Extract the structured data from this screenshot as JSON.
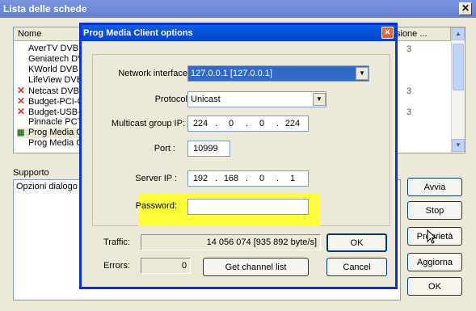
{
  "back": {
    "title": "Lista delle schede",
    "close_label": "✕",
    "headers": {
      "name": "Nome",
      "version": "sione ..."
    },
    "rows": [
      {
        "label": "AverTV DVB",
        "icon": ""
      },
      {
        "label": "Geniatech DV",
        "icon": ""
      },
      {
        "label": "KWorld DVB",
        "icon": ""
      },
      {
        "label": "LifeView DVB",
        "icon": ""
      },
      {
        "label": "Netcast DVB",
        "icon": "✕"
      },
      {
        "label": "Budget-PCI-C",
        "icon": "✕"
      },
      {
        "label": "Budget-USB-",
        "icon": "✕"
      },
      {
        "label": "Pinnacle PCT",
        "icon": ""
      },
      {
        "label": "Prog Media C",
        "icon": "▦"
      },
      {
        "label": "Prog Media C",
        "icon": ""
      }
    ],
    "supporto_label": "Supporto",
    "supporto_item": "Opzioni dialogo",
    "buttons": {
      "avvia": "Avvia",
      "stop": "Stop",
      "proprieta": "Proprietà",
      "aggiorna": "Aggiorna",
      "ok": "OK"
    }
  },
  "dialog": {
    "title": "Prog Media Client options",
    "close_label": "✕",
    "network_label": "Network interface:",
    "network_value": "127.0.0.1    [127.0.0.1]",
    "protocol_label": "Protocol:",
    "protocol_value": "Unicast",
    "multicast_label": "Multicast group IP:",
    "multicast_ip": [
      "224",
      "0",
      "0",
      "224"
    ],
    "port_label": "Port :",
    "port_value": "10999",
    "server_label": "Server IP :",
    "server_ip": [
      "192",
      "168",
      "0",
      "1"
    ],
    "password_label": "Password:",
    "password_value": "",
    "traffic_label": "Traffic:",
    "traffic_value": "14 056 074  [935 892 byte/s]",
    "errors_label": "Errors:",
    "errors_value": "0",
    "ok_label": "OK",
    "channel_label": "Get channel list",
    "cancel_label": "Cancel",
    "highlight_color": "#ffff3a"
  }
}
